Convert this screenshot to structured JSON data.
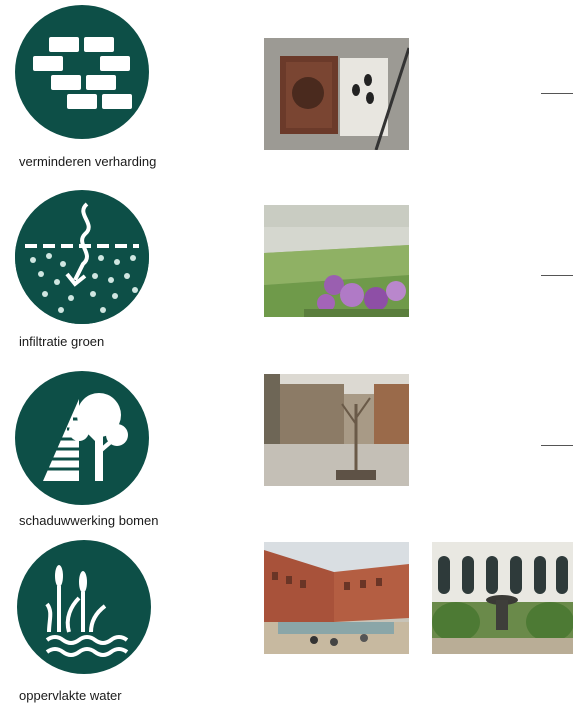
{
  "measures": [
    {
      "label": "verminderen verharding",
      "icon": "paving-bricks-icon",
      "photos": [
        "tree-grate-photo"
      ]
    },
    {
      "label": "infiltratie groen",
      "icon": "soil-infiltration-icon",
      "photos": [
        "garden-lawn-photo"
      ]
    },
    {
      "label": "schaduwwerking bomen",
      "icon": "tree-shade-icon",
      "photos": [
        "courtyard-tree-photo"
      ]
    },
    {
      "label": "oppervlakte water",
      "icon": "water-reeds-icon",
      "photos": [
        "water-square-photo",
        "fountain-garden-photo"
      ]
    }
  ],
  "colors": {
    "icon_bg": "#0d4f47",
    "icon_fg": "#ffffff"
  }
}
